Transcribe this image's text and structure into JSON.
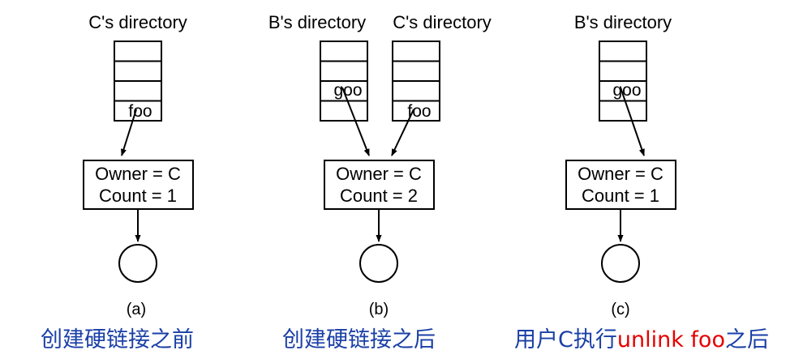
{
  "panels": [
    {
      "directories": [
        {
          "title": "C's directory",
          "entry": "foo"
        }
      ],
      "inode": {
        "owner": "Owner = C",
        "count": "Count = 1"
      },
      "sublabel": "(a)",
      "caption": "创建硬链接之前"
    },
    {
      "directories": [
        {
          "title": "B's directory",
          "entry": "goo"
        },
        {
          "title": "C's directory",
          "entry": "foo"
        }
      ],
      "inode": {
        "owner": "Owner = C",
        "count": "Count = 2"
      },
      "sublabel": "(b)",
      "caption": "创建硬链接之后"
    },
    {
      "directories": [
        {
          "title": "B's directory",
          "entry": "goo"
        }
      ],
      "inode": {
        "owner": "Owner = C",
        "count": "Count = 1"
      },
      "sublabel": "(c)",
      "caption_parts": [
        "用户C执行",
        "unlink foo",
        "之后"
      ]
    }
  ],
  "colors": {
    "caption": "#1a3fa6",
    "highlight": "#e60000",
    "line": "#000000"
  }
}
